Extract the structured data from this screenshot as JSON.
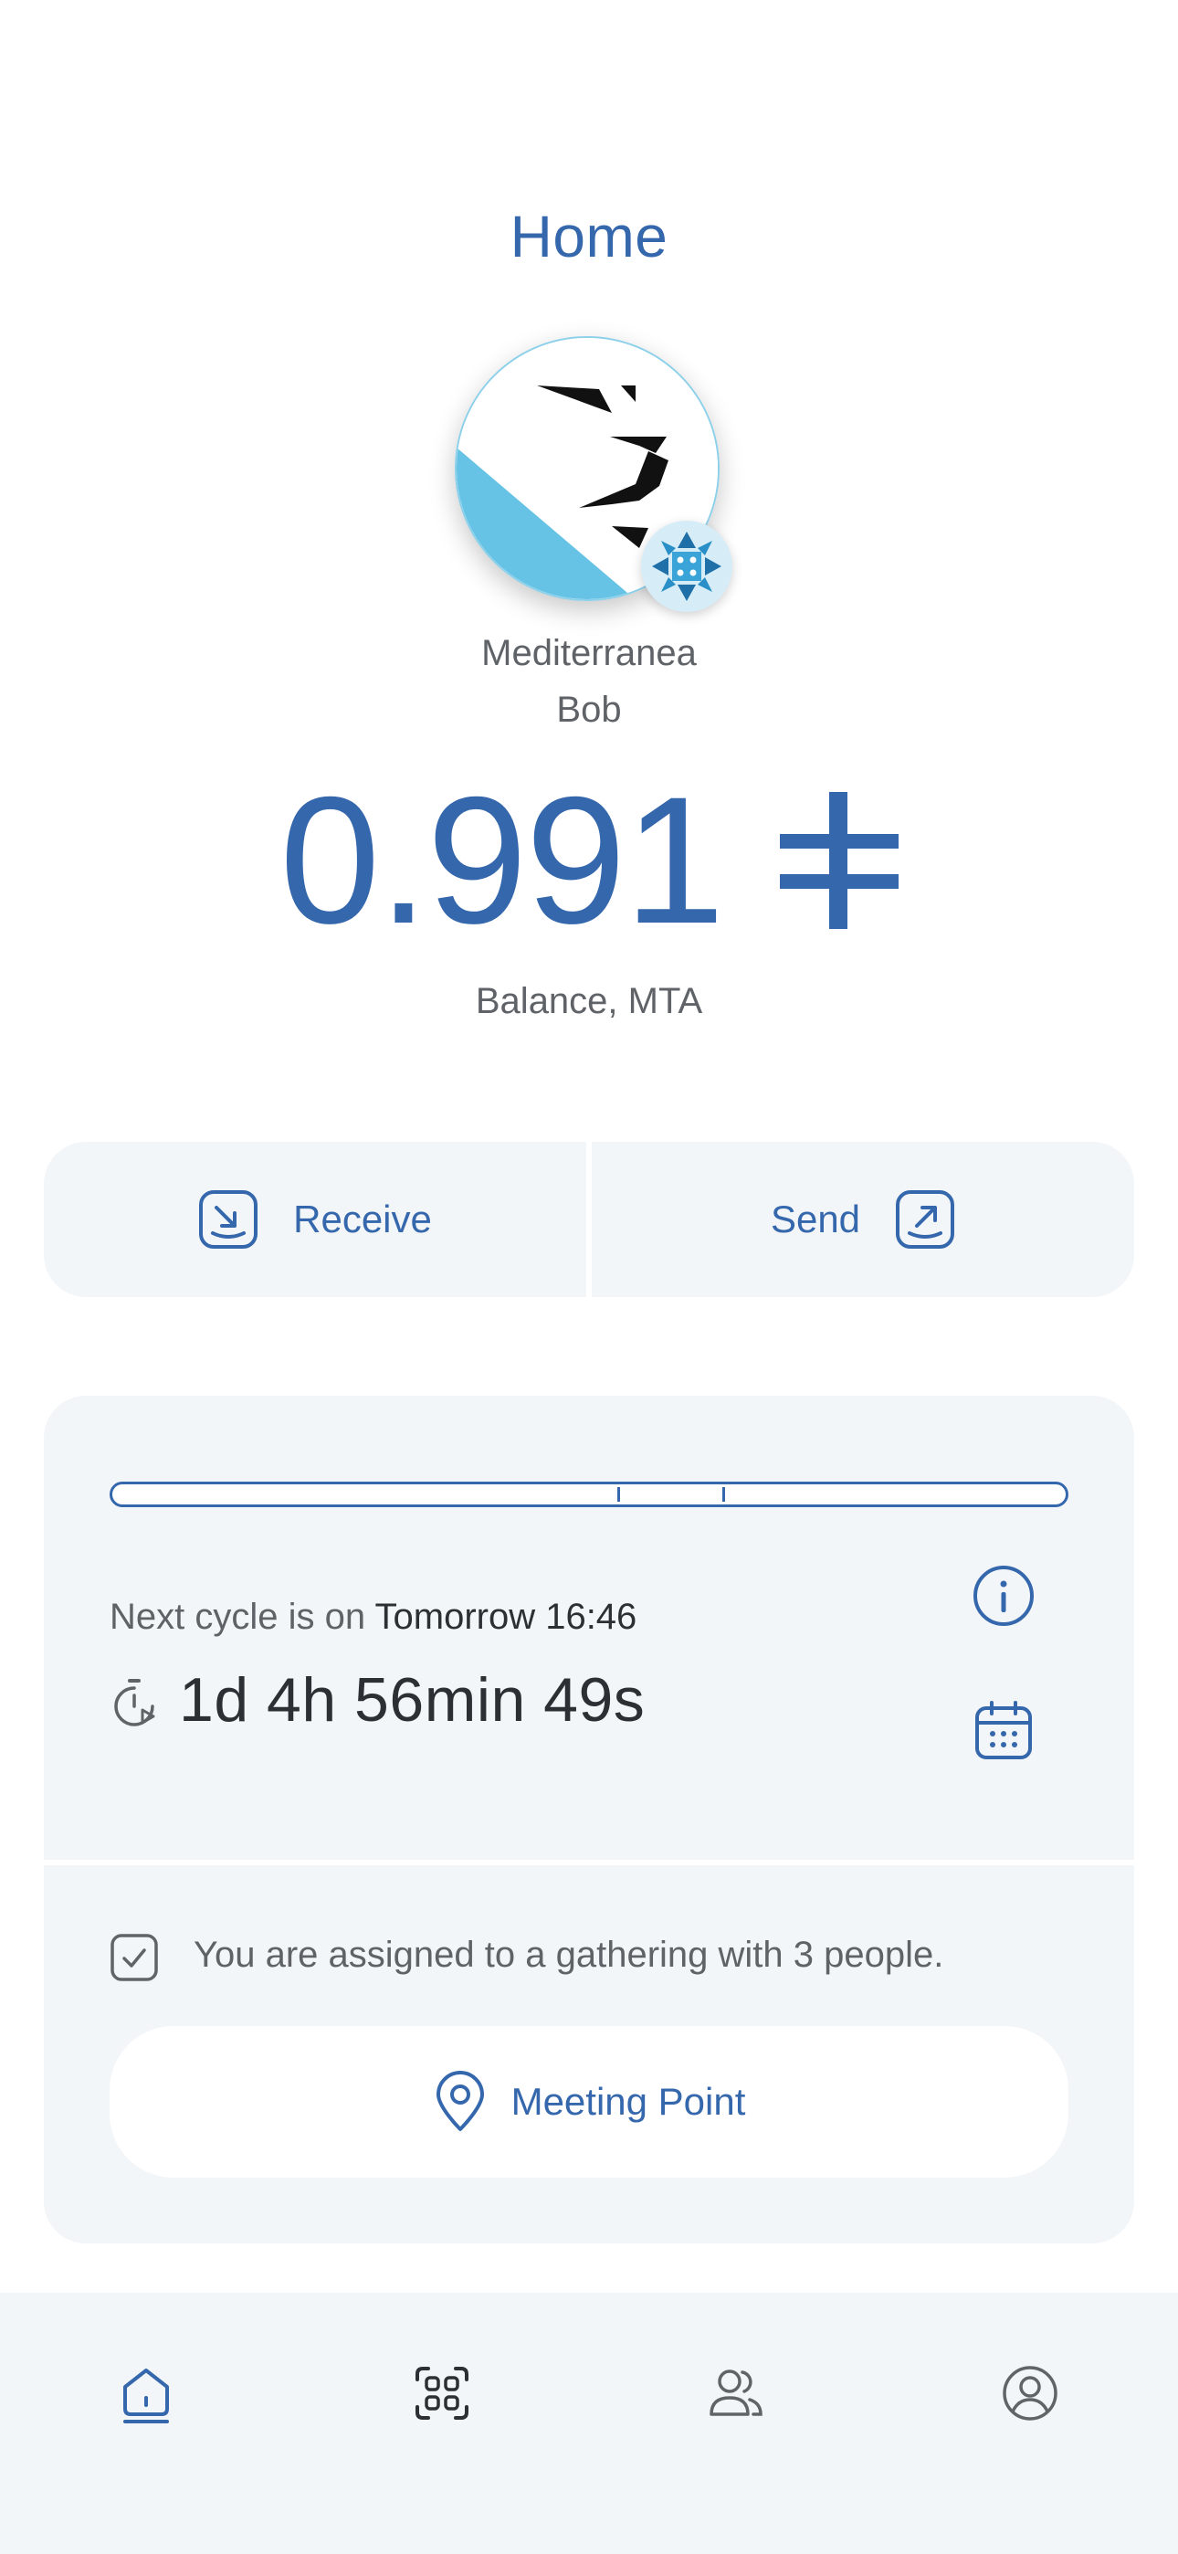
{
  "header": {
    "title": "Home"
  },
  "community": {
    "name_line1": "Mediterranea",
    "name_line2": "Bob"
  },
  "balance": {
    "value": "0.991",
    "currency_icon": "leu-currency-symbol",
    "label": "Balance, MTA"
  },
  "actions": {
    "receive_label": "Receive",
    "receive_icon": "arrow-down-tray-icon",
    "send_label": "Send",
    "send_icon": "arrow-up-tray-icon"
  },
  "cycle": {
    "progress_fraction": 0.53,
    "phase_markers": [
      0.53,
      0.64
    ],
    "next_cycle_prefix": "Next cycle is on",
    "next_cycle_time": "Tomorrow 16:46",
    "countdown": "1d 4h 56min 49s"
  },
  "meetup": {
    "assigned_text": "You are assigned to a gathering with 3 people.",
    "meeting_point_label": "Meeting Point"
  },
  "tabs": [
    {
      "name": "home",
      "icon": "home-icon",
      "active": true
    },
    {
      "name": "scan",
      "icon": "qr-scan-icon",
      "active": false
    },
    {
      "name": "contacts",
      "icon": "people-icon",
      "active": false
    },
    {
      "name": "profile",
      "icon": "user-circle-icon",
      "active": false
    }
  ],
  "colors": {
    "accent": "#3567ad",
    "card": "#f3f6f8",
    "text": "#5f6368",
    "avatar_blue": "#67c3e5"
  }
}
